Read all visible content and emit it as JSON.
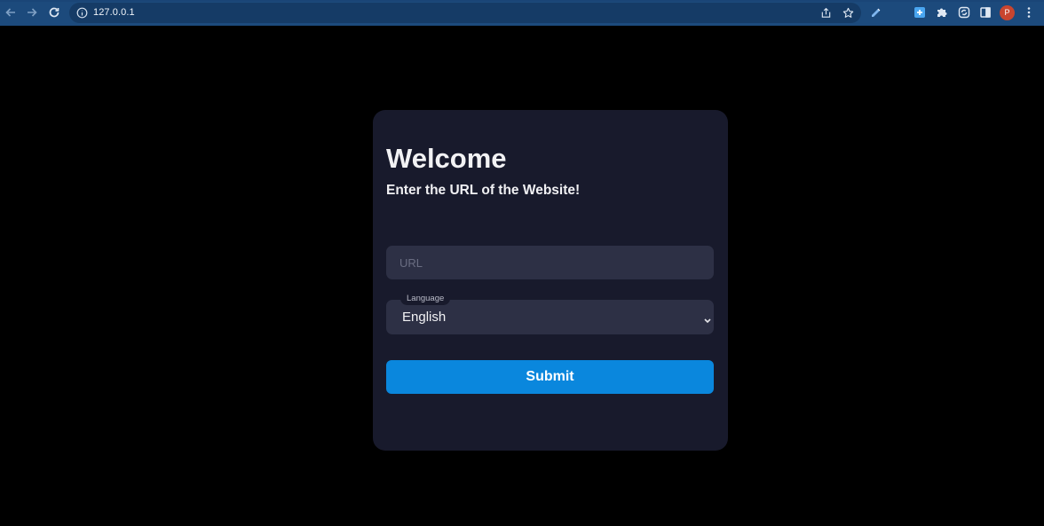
{
  "browser": {
    "url": "127.0.0.1",
    "avatar_initial": "P",
    "toolbar_color": "#1c4a7c",
    "icons": [
      "back-arrow-icon",
      "forward-arrow-icon",
      "reload-icon",
      "site-info-icon",
      "share-icon",
      "bookmark-star-icon",
      "extension-pen-icon",
      "extension-plus-icon",
      "extensions-puzzle-icon",
      "sync-icon",
      "side-panel-icon",
      "menu-kebab-icon"
    ]
  },
  "card": {
    "title": "Welcome",
    "subtitle": "Enter the URL of the Website!",
    "url_field": {
      "placeholder": "URL",
      "value": ""
    },
    "language": {
      "label": "Language",
      "selected": "English"
    },
    "submit_label": "Submit"
  },
  "colors": {
    "background": "#000000",
    "card": "#181a2c",
    "field": "#2d3045",
    "accent": "#0a87dd"
  }
}
